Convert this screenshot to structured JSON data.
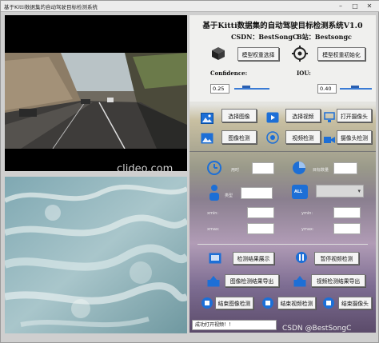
{
  "window": {
    "title": "基于Kitti数据集的自动驾驶目标检测系统",
    "min": "–",
    "max": "□",
    "close": "✕"
  },
  "video_panel": {
    "watermark": "clideo.com"
  },
  "header": {
    "system_title": "基于Kitti数据集的自动驾驶目标检测系统V1.0",
    "csdn": "CSDN：BestSongC",
    "bilibili": "B站：Bestsongc"
  },
  "model": {
    "select_label": "模型权重选择",
    "init_label": "模型权重初始化"
  },
  "params": {
    "confidence_label": "Confidence:",
    "confidence_value": "0.25",
    "iou_label": "IOU:",
    "iou_value": "0.40"
  },
  "actions": {
    "select_image": "选择图像",
    "select_video": "选择视频",
    "open_camera": "打开摄像头",
    "image_detect": "图像检测",
    "video_detect": "视频检测",
    "camera_detect": "摄像头检测"
  },
  "stats": {
    "time_label": "用时",
    "count_label": "目标数量",
    "type_label": "类型",
    "conf_label": "置信度",
    "xmin_label": "xmin:",
    "ymin_label": "ymin:",
    "xmax_label": "xmax:",
    "ymax_label": "ymax:",
    "all_label": "ALL"
  },
  "bottom": {
    "show_results": "检测结果展示",
    "pause_video": "暂停视频检测",
    "export_image": "图像检测结果导出",
    "export_video": "视频检测结果导出",
    "end_image": "结束图像检测",
    "end_video": "结束视频检测",
    "end_camera": "结束摄像头"
  },
  "status": {
    "message": "成功打开视频！！"
  },
  "corner_watermark": "CSDN @BestSongC",
  "colors": {
    "accent_blue": "#2a6fd0",
    "panel_black": "#000000"
  }
}
